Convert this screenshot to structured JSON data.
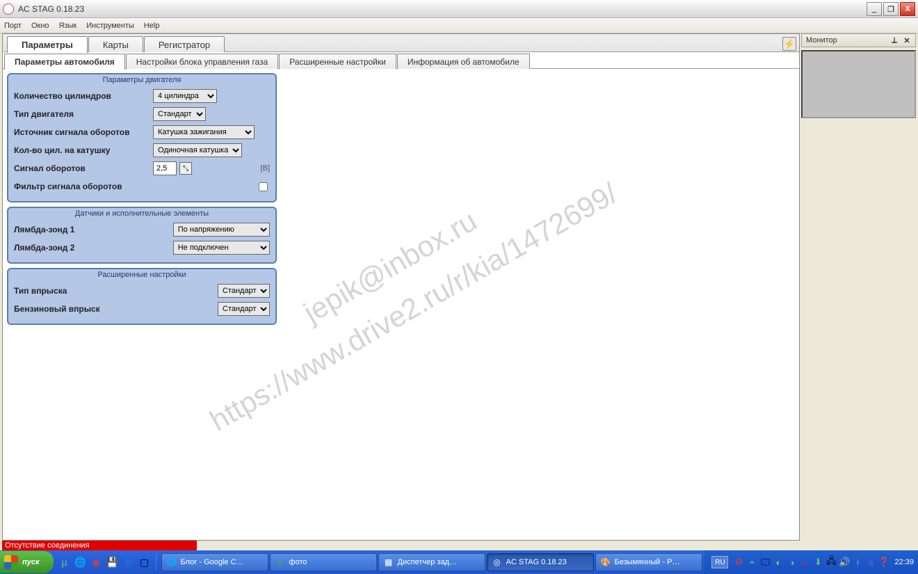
{
  "title": "AC STAG 0.18.23",
  "menu": {
    "port": "Порт",
    "window": "Окно",
    "lang": "Язык",
    "tools": "Инструменты",
    "help": "Help"
  },
  "tabs": {
    "params": "Параметры",
    "maps": "Карты",
    "recorder": "Регистратор"
  },
  "subtabs": {
    "car_params": "Параметры автомобиля",
    "gas_ecu": "Настройки блока управления газа",
    "advanced": "Расширенные настройки",
    "car_info": "Информация об автомобиле"
  },
  "engine": {
    "legend": "Параметры двигателя",
    "num_cyl_label": "Количество цилиндров",
    "num_cyl_value": "4 цилиндра",
    "engine_type_label": "Тип двигателя",
    "engine_type_value": "Стандарт",
    "rpm_source_label": "Источник сигнала оборотов",
    "rpm_source_value": "Катушка зажигания",
    "cyl_per_coil_label": "Кол-во цил. на катушку",
    "cyl_per_coil_value": "Одиночная катушка",
    "rpm_signal_label": "Сигнал оборотов",
    "rpm_signal_value": "2,5",
    "rpm_signal_unit": "[B]",
    "rpm_filter_label": "Фильтр сигнала оборотов"
  },
  "sensors": {
    "legend": "Датчики и исполнительные элементы",
    "l1_label": "Лямбда-зонд 1",
    "l1_value": "По напряжению",
    "l2_label": "Лямбда-зонд 2",
    "l2_value": "Не подключен"
  },
  "adv": {
    "legend": "Расширенные настройки",
    "inj_type_label": "Тип впрыска",
    "inj_type_value": "Стандарт",
    "petrol_inj_label": "Бензиновый впрыск",
    "petrol_inj_value": "Стандарт"
  },
  "monitor": {
    "title": "Монитор"
  },
  "status": "Отсутствие соединения",
  "taskbar": {
    "start": "пуск",
    "t1": "Блог - Google C…",
    "t2": "фото",
    "t3": "Диспетчер зад…",
    "t4": "AC STAG 0.18.23",
    "t5": "Безымянный - P…",
    "lang": "RU",
    "clock": "22:39"
  },
  "watermark": "jepik@inbox.ru\nhttps://www.drive2.ru/r/kia/1472699/"
}
